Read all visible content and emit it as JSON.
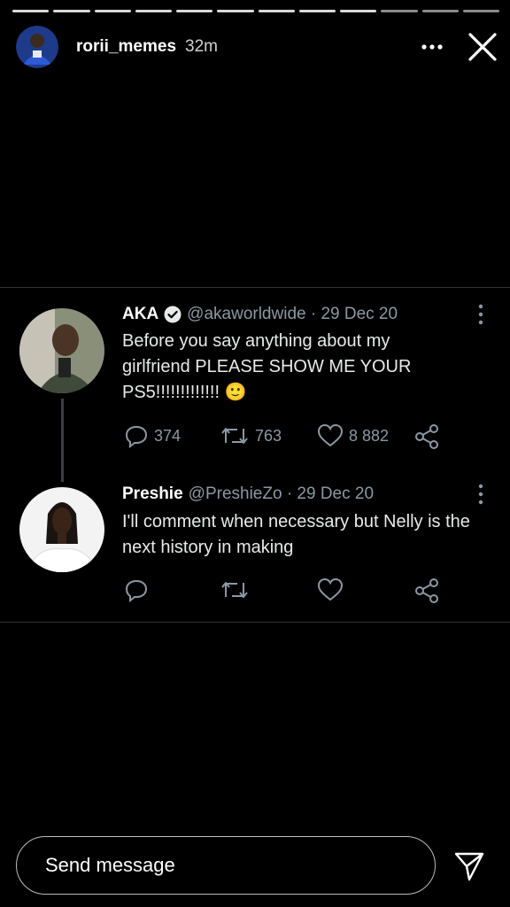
{
  "story": {
    "username": "rorii_memes",
    "time_ago": "32m",
    "progress_segments": 12,
    "progress_done": 9
  },
  "tweets": [
    {
      "name": "AKA",
      "verified": true,
      "handle": "@akaworldwide · 29 Dec 20",
      "text": "Before you say anything about my girlfriend PLEASE SHOW ME YOUR PS5!!!!!!!!!!!!! 🙂",
      "replies": "374",
      "retweets": "763",
      "likes": "8 882"
    },
    {
      "name": "Preshie",
      "verified": false,
      "handle": "@PreshieZo · 29 Dec 20",
      "text": "I'll comment when necessary  but Nelly is the next history in making",
      "replies": "",
      "retweets": "",
      "likes": ""
    }
  ],
  "composer": {
    "placeholder": "Send message"
  },
  "colors": {
    "background": "#000000",
    "muted": "#8b98a5",
    "divider": "#2f3336"
  },
  "icons": [
    "more-icon",
    "close-icon",
    "verified-icon",
    "reply-icon",
    "retweet-icon",
    "like-icon",
    "share-icon",
    "send-icon"
  ]
}
